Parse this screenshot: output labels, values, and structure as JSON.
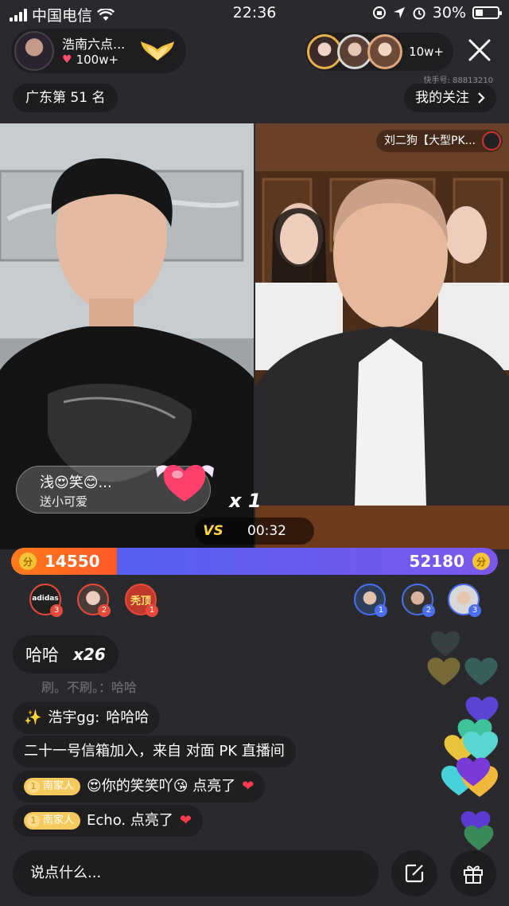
{
  "status_bar": {
    "carrier": "中国电信",
    "time": "22:36",
    "battery": "30%"
  },
  "header": {
    "host_name": "浩南六点...",
    "host_likes": "100w+",
    "viewer_count": "10w+",
    "blurred_id": "快手号: 88813210",
    "rank_label": "广东第 51 名",
    "follow_label": "我的关注"
  },
  "pk": {
    "opponent_name": "刘二狗【大型PK...",
    "gift_name": "浅😍笑😊...",
    "gift_desc": "送小可爱",
    "gift_multiplier": "x 1",
    "vs_label": "VS",
    "timer": "00:32",
    "left_score": "14550",
    "right_score": "52180",
    "left_share": 0.218,
    "coin_label": "分"
  },
  "contributors": {
    "left": [
      {
        "name": "adidas",
        "rank": "3"
      },
      {
        "name": "",
        "rank": "2"
      },
      {
        "name": "秃顶",
        "rank": "1"
      }
    ],
    "right": [
      {
        "rank": "1"
      },
      {
        "rank": "2"
      },
      {
        "rank": "3"
      }
    ]
  },
  "chat": {
    "combo_text": "哈哈",
    "combo_count": "x26",
    "faded_text": "刷。不刷。：哈哈",
    "messages": [
      {
        "prefix": "✨",
        "user": "浩宇gg:",
        "text": "哈哈哈"
      },
      {
        "text": "二十一号信箱加入，来自 对面 PK 直播间"
      },
      {
        "badge_level": "1",
        "badge_name": "南家人",
        "text": "😍你的笑笑吖😘 点亮了"
      },
      {
        "badge_level": "1",
        "badge_name": "南家人",
        "text": "Echo. 点亮了"
      }
    ]
  },
  "bottom": {
    "input_placeholder": "说点什么..."
  },
  "colors": {
    "pk_left": "#ff6a22",
    "pk_right": "#5a60f0",
    "fan_badge": "#f4c95d"
  }
}
